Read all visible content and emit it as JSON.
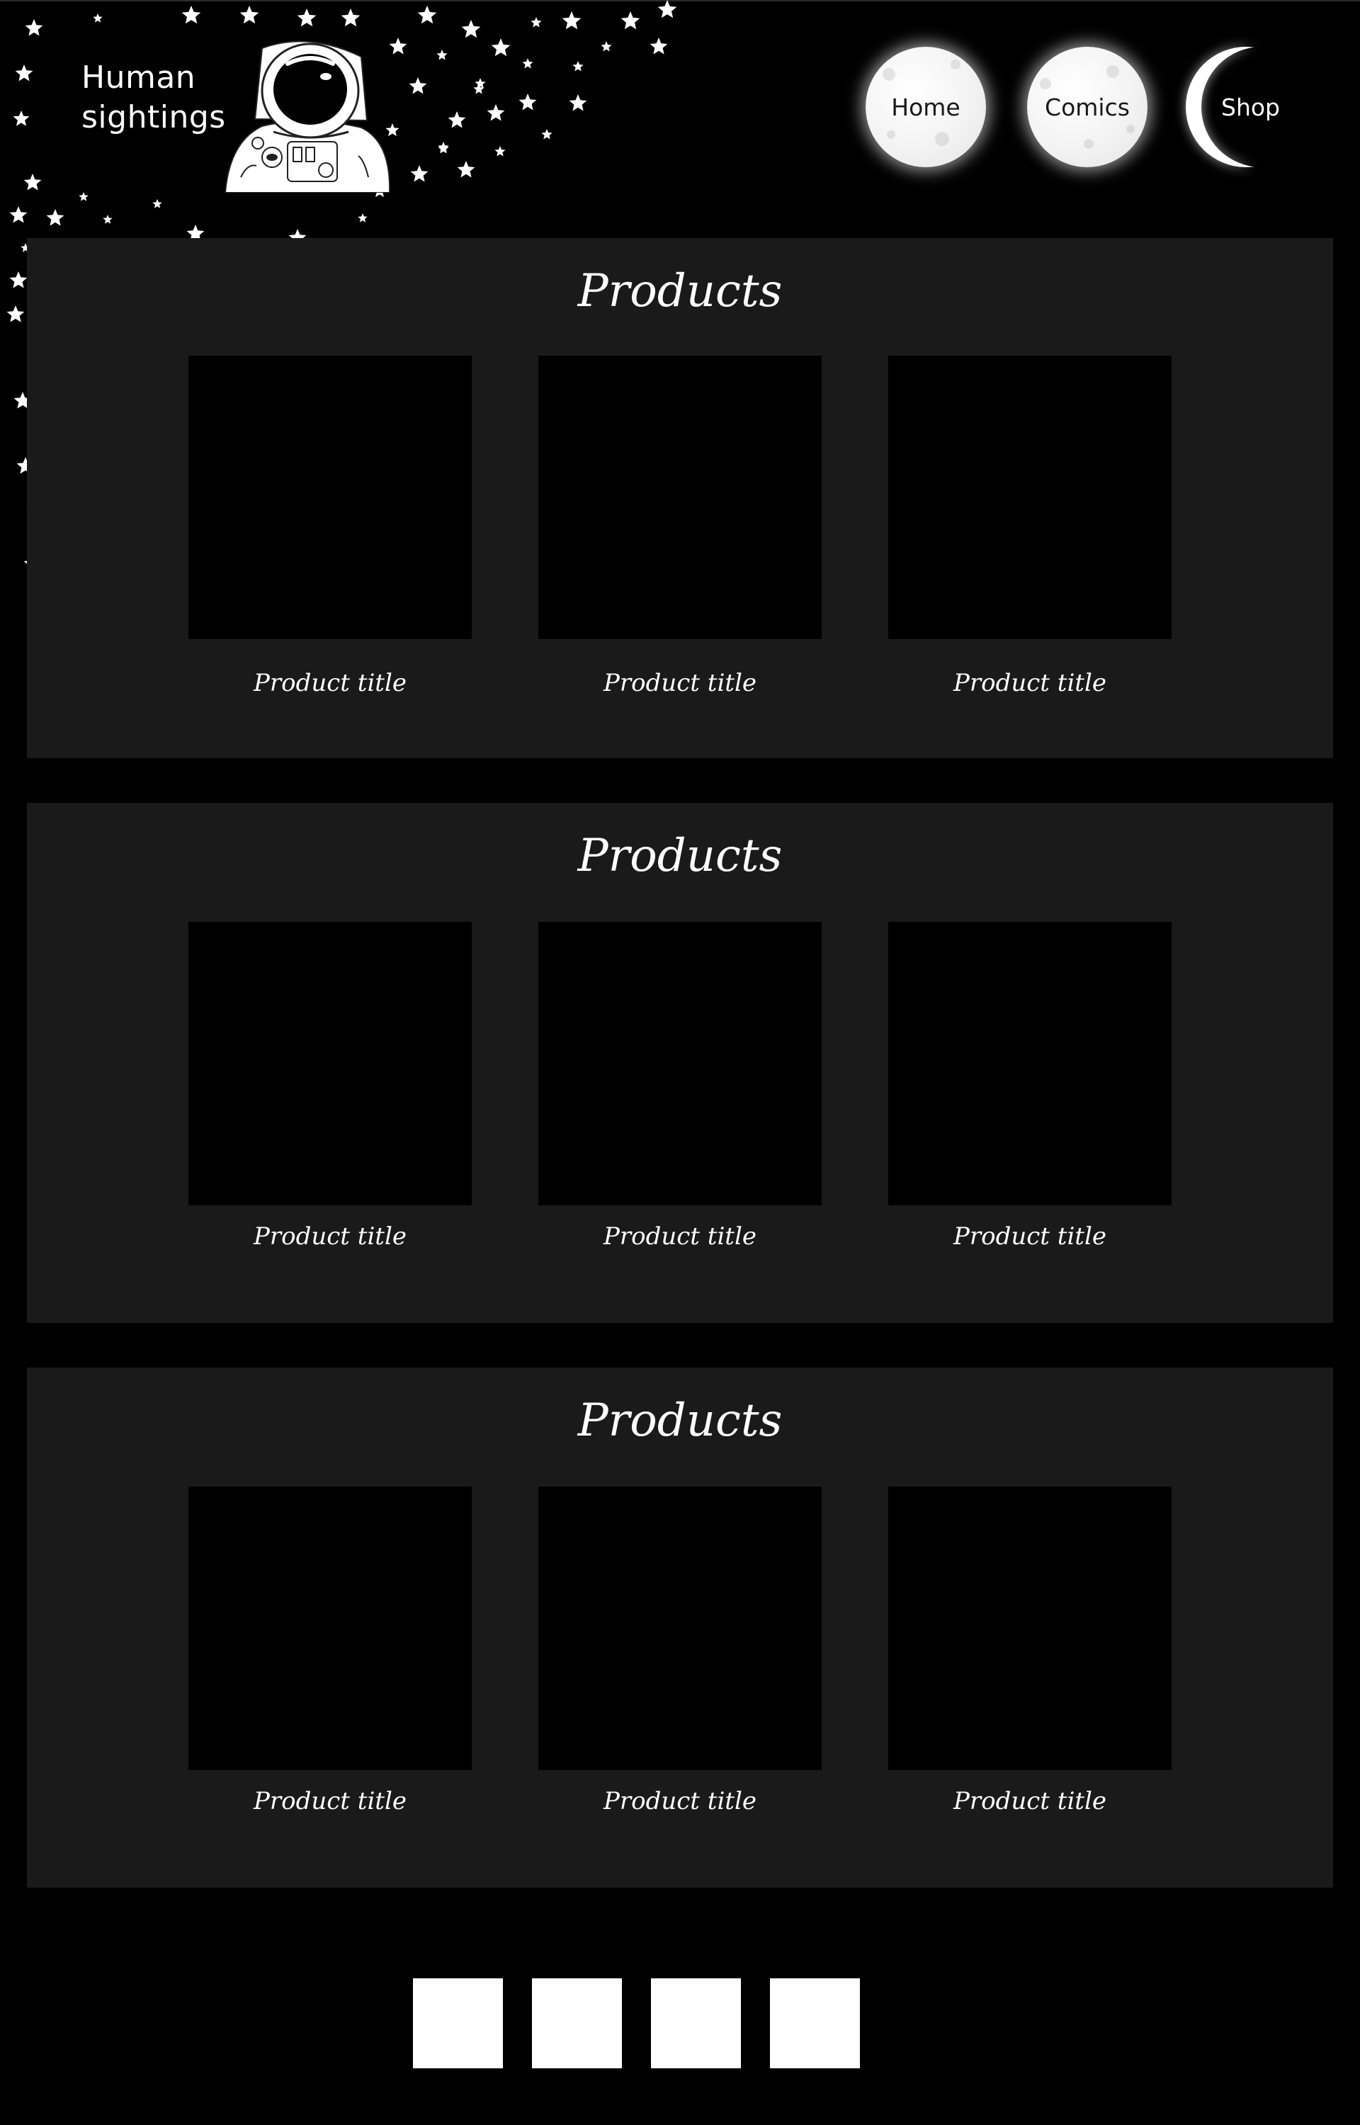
{
  "brand": {
    "line1": "Human",
    "line2": "sightings"
  },
  "nav": {
    "items": [
      {
        "label": "Home"
      },
      {
        "label": "Comics"
      },
      {
        "label": "Shop"
      }
    ]
  },
  "sections": [
    {
      "title": "Products",
      "products": [
        {
          "title": "Product title"
        },
        {
          "title": "Product title"
        },
        {
          "title": "Product title"
        }
      ]
    },
    {
      "title": "Products",
      "products": [
        {
          "title": "Product title"
        },
        {
          "title": "Product title"
        },
        {
          "title": "Product title"
        }
      ]
    },
    {
      "title": "Products",
      "products": [
        {
          "title": "Product title"
        },
        {
          "title": "Product title"
        },
        {
          "title": "Product title"
        }
      ]
    }
  ],
  "pagination": {
    "page_count": 4
  },
  "icons": {
    "decoration": "star-field",
    "logo": "astronaut-icon",
    "nav": "moon-icon"
  },
  "colors": {
    "background": "#000000",
    "panel": "#1a1a1a",
    "text": "#ffffff",
    "moon": "#f3f3f3"
  }
}
